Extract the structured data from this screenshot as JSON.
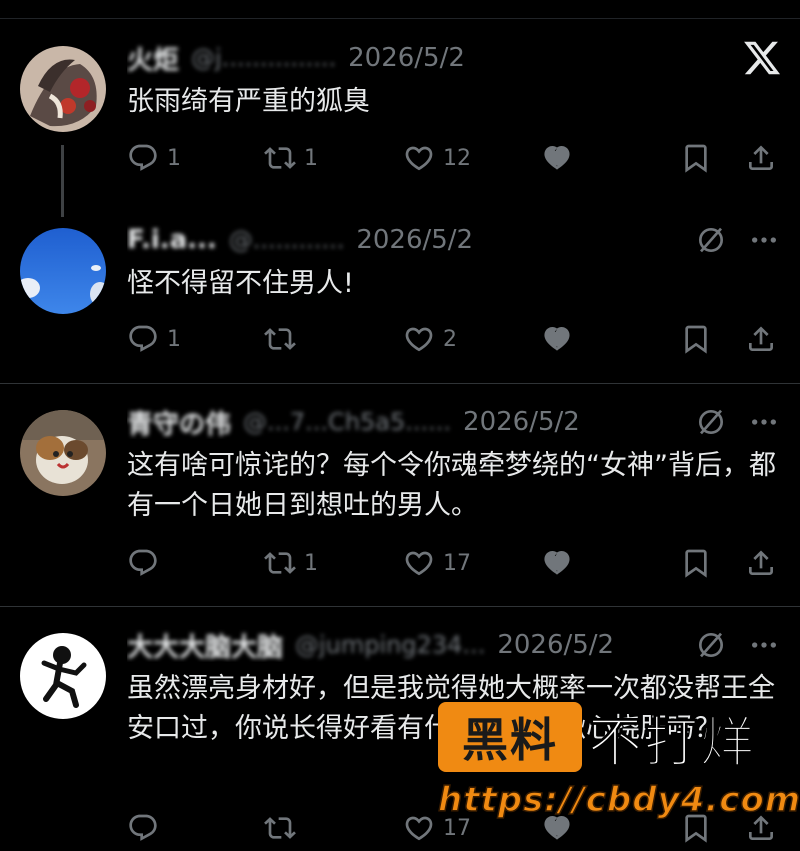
{
  "tweets": [
    {
      "name": "火炬",
      "handle": "@j...............",
      "date": "2026/5/2",
      "text": "张雨绮有严重的狐臭",
      "stats": {
        "replies": "1",
        "retweets": "1",
        "likes": "12"
      }
    },
    {
      "name": "F.i.a...",
      "handle": "@............",
      "date": "2026/5/2",
      "text": "怪不得留不住男人!",
      "stats": {
        "replies": "1",
        "retweets": "",
        "likes": "2"
      }
    },
    {
      "name": "青守の伟",
      "handle": "@...7...Ch5a5......",
      "date": "2026/5/2",
      "text": "这有啥可惊诧的？每个令你魂牵梦绕的“女神”背后，都有一个日她日到想吐的男人。",
      "stats": {
        "replies": "",
        "retweets": "1",
        "likes": "17"
      }
    },
    {
      "name": "大大大脑大脑",
      "handle": "@jumping234...",
      "date": "2026/5/2",
      "text": "虽然漂亮身材好，但是我觉得她大概率一次都没帮王全安口过，你说长得好看有什么用，不揪心挠肝吗？",
      "stats": {
        "replies": "",
        "retweets": "",
        "likes": "17"
      }
    }
  ],
  "watermark": {
    "badge": "黑料",
    "title": "不打烊",
    "url": "https://cbdy4.com"
  },
  "icons": {
    "logo": "x-logo-icon",
    "reply": "reply-icon",
    "retweet": "retweet-icon",
    "like": "heart-icon",
    "grok": "grok-icon",
    "bookmark": "bookmark-icon",
    "share": "share-icon",
    "mute": "mute-icon",
    "more": "more-icon"
  },
  "colors": {
    "background": "#000000",
    "text": "#e7e9ea",
    "secondary": "#71767b",
    "watermark_orange": "#f08a12"
  }
}
